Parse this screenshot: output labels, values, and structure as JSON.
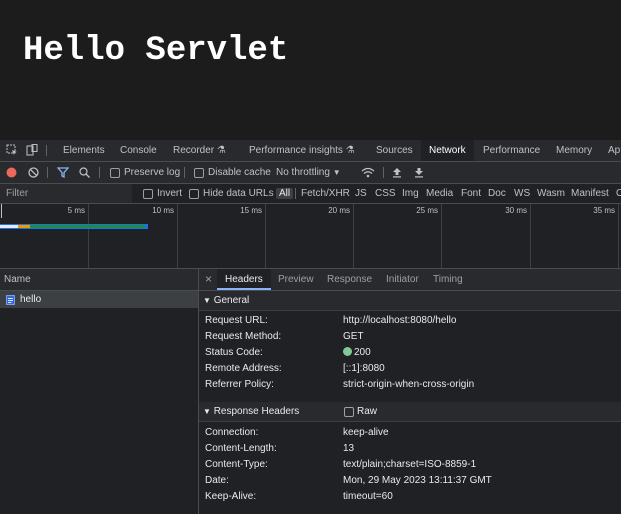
{
  "page": {
    "heading": "Hello Servlet"
  },
  "devtools": {
    "tabs": [
      "Elements",
      "Console",
      "Recorder",
      "Performance insights",
      "Sources",
      "Network",
      "Performance",
      "Memory",
      "Ap"
    ],
    "active_tab": "Network",
    "toolbar": {
      "preserve_log": "Preserve log",
      "disable_cache": "Disable cache",
      "throttling": "No throttling"
    },
    "filter": {
      "placeholder": "Filter",
      "invert": "Invert",
      "hide_data_urls": "Hide data URLs",
      "types": [
        "All",
        "Fetch/XHR",
        "JS",
        "CSS",
        "Img",
        "Media",
        "Font",
        "Doc",
        "WS",
        "Wasm",
        "Manifest",
        "O"
      ]
    },
    "timeline": {
      "ticks": [
        "5 ms",
        "10 ms",
        "15 ms",
        "20 ms",
        "25 ms",
        "30 ms",
        "35 ms"
      ]
    },
    "requests": {
      "column": "Name",
      "items": [
        "hello"
      ]
    },
    "details": {
      "close": "×",
      "tabs": [
        "Headers",
        "Preview",
        "Response",
        "Initiator",
        "Timing"
      ],
      "active_tab": "Headers",
      "general": {
        "title": "General",
        "rows": [
          {
            "k": "Request URL:",
            "v": "http://localhost:8080/hello"
          },
          {
            "k": "Request Method:",
            "v": "GET"
          },
          {
            "k": "Status Code:",
            "v": "200"
          },
          {
            "k": "Remote Address:",
            "v": "[::1]:8080"
          },
          {
            "k": "Referrer Policy:",
            "v": "strict-origin-when-cross-origin"
          }
        ]
      },
      "response_headers": {
        "title": "Response Headers",
        "raw_label": "Raw",
        "rows": [
          {
            "k": "Connection:",
            "v": "keep-alive"
          },
          {
            "k": "Content-Length:",
            "v": "13"
          },
          {
            "k": "Content-Type:",
            "v": "text/plain;charset=ISO-8859-1"
          },
          {
            "k": "Date:",
            "v": "Mon, 29 May 2023 13:11:37 GMT"
          },
          {
            "k": "Keep-Alive:",
            "v": "timeout=60"
          }
        ]
      }
    }
  },
  "colors": {
    "accent": "#8ab4f8",
    "record": "#ee675c",
    "status_ok": "#81c995",
    "bar_green": "#1e8e3e",
    "bar_blue": "#1a73e8"
  }
}
